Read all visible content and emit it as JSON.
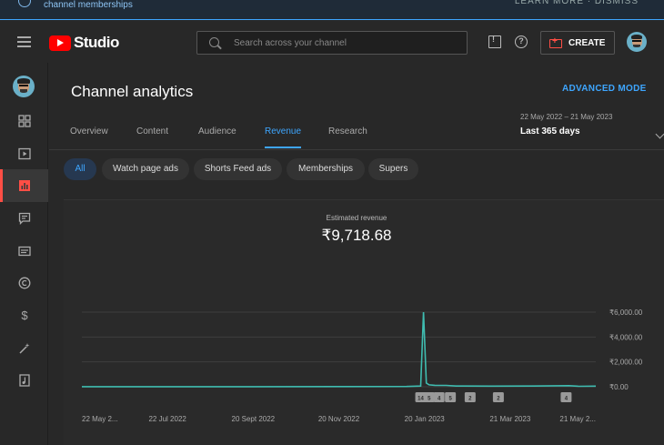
{
  "banner": {
    "text": "channel memberships"
  },
  "header": {
    "logo_text": "Studio",
    "search_placeholder": "Search across your channel",
    "create_label": "CREATE",
    "icons": [
      "menu-icon",
      "feedback-icon",
      "help-icon",
      "create-video-icon"
    ]
  },
  "sidebar": {
    "items": [
      {
        "name": "dashboard",
        "icon": "dashboard-icon"
      },
      {
        "name": "content",
        "icon": "content-icon"
      },
      {
        "name": "analytics",
        "icon": "analytics-icon",
        "active": true
      },
      {
        "name": "comments",
        "icon": "comments-icon"
      },
      {
        "name": "subtitles",
        "icon": "subtitles-icon"
      },
      {
        "name": "copyright",
        "icon": "copyright-icon"
      },
      {
        "name": "earn",
        "icon": "dollar-icon"
      },
      {
        "name": "customisation",
        "icon": "magic-wand-icon"
      },
      {
        "name": "audio-library",
        "icon": "audio-library-icon"
      }
    ]
  },
  "main": {
    "title": "Channel analytics",
    "advanced_mode": "ADVANCED MODE",
    "tabs": [
      {
        "label": "Overview"
      },
      {
        "label": "Content"
      },
      {
        "label": "Audience"
      },
      {
        "label": "Revenue",
        "active": true
      },
      {
        "label": "Research"
      }
    ],
    "date_range": "22 May 2022 – 21 May 2023",
    "period": "Last 365 days",
    "chips": [
      {
        "label": "All",
        "active": true
      },
      {
        "label": "Watch page ads"
      },
      {
        "label": "Shorts Feed ads"
      },
      {
        "label": "Memberships"
      },
      {
        "label": "Supers"
      }
    ],
    "metric_label": "Estimated revenue",
    "metric_value": "₹9,718.68"
  },
  "colors": {
    "accent": "#3ea6ff",
    "line": "#3fbcb0",
    "brand": "#ff0000"
  },
  "chart_data": {
    "type": "line",
    "xlabel": "",
    "ylabel": "",
    "x_tick_labels": [
      "22 May 2...",
      "22 Jul 2022",
      "20 Sept 2022",
      "20 Nov 2022",
      "20 Jan 2023",
      "21 Mar 2023",
      "21 May 2..."
    ],
    "y_tick_labels": [
      "₹6,000.00",
      "₹4,000.00",
      "₹2,000.00",
      "₹0.00"
    ],
    "ylim": [
      0,
      6000
    ],
    "xlim_days": [
      0,
      364
    ],
    "series": [
      {
        "points": [
          [
            0,
            5
          ],
          [
            60,
            10
          ],
          [
            120,
            8
          ],
          [
            180,
            15
          ],
          [
            230,
            20
          ],
          [
            240,
            60
          ],
          [
            242,
            6000
          ],
          [
            244,
            300
          ],
          [
            246,
            150
          ],
          [
            250,
            120
          ],
          [
            258,
            110
          ],
          [
            265,
            60
          ],
          [
            290,
            50
          ],
          [
            320,
            60
          ],
          [
            345,
            90
          ],
          [
            352,
            40
          ],
          [
            364,
            50
          ]
        ]
      }
    ],
    "markers": [
      "14",
      "5",
      "4",
      "5",
      "2",
      "2",
      "4"
    ],
    "marker_days": [
      240,
      246,
      253,
      261,
      275,
      295,
      343
    ]
  }
}
